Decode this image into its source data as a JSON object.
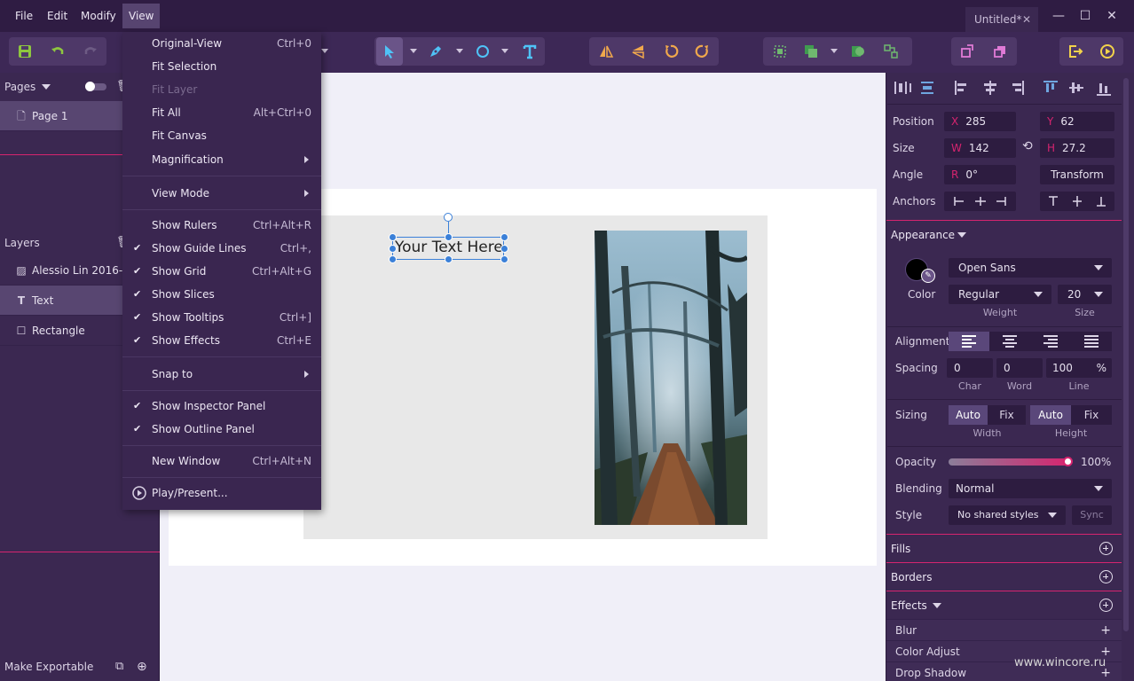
{
  "menubar": {
    "file": "File",
    "edit": "Edit",
    "modify": "Modify",
    "view": "View"
  },
  "document_tab": {
    "title": "Untitled*",
    "close": "✕"
  },
  "window_controls": {
    "minimize": "—",
    "maximize": "☐",
    "close": "✕"
  },
  "view_menu": {
    "items": [
      {
        "label": "Original-View",
        "shortcut": "Ctrl+0"
      },
      {
        "label": "Fit Selection",
        "shortcut": ""
      },
      {
        "label": "Fit Layer",
        "shortcut": ""
      },
      {
        "label": "Fit All",
        "shortcut": "Alt+Ctrl+0"
      },
      {
        "label": "Fit Canvas",
        "shortcut": ""
      },
      {
        "label": "Magnification",
        "shortcut": ""
      },
      {
        "label": "View Mode",
        "shortcut": ""
      },
      {
        "label": "Show Rulers",
        "shortcut": "Ctrl+Alt+R"
      },
      {
        "label": "Show Guide Lines",
        "shortcut": "Ctrl+,"
      },
      {
        "label": "Show Grid",
        "shortcut": "Ctrl+Alt+G"
      },
      {
        "label": "Show Slices",
        "shortcut": ""
      },
      {
        "label": "Show Tooltips",
        "shortcut": "Ctrl+]"
      },
      {
        "label": "Show Effects",
        "shortcut": "Ctrl+E"
      },
      {
        "label": "Snap to",
        "shortcut": ""
      },
      {
        "label": "Show Inspector Panel",
        "shortcut": ""
      },
      {
        "label": "Show Outline Panel",
        "shortcut": ""
      },
      {
        "label": "New Window",
        "shortcut": "Ctrl+Alt+N"
      },
      {
        "label": "Play/Present...",
        "shortcut": ""
      }
    ],
    "check": "✔"
  },
  "left_panel": {
    "pages_label": "Pages",
    "pages": [
      {
        "label": "Page 1"
      }
    ],
    "layers_label": "Layers",
    "layers": [
      {
        "label": "Alessio Lin 2016-..."
      },
      {
        "label": "Text"
      },
      {
        "label": "Rectangle"
      }
    ],
    "footer_label": "Make Exportable"
  },
  "canvas": {
    "text_layer": "Your Text Here"
  },
  "inspector": {
    "position_label": "Position",
    "x_prefix": "X",
    "x_value": "285",
    "y_prefix": "Y",
    "y_value": "62",
    "size_label": "Size",
    "w_prefix": "W",
    "w_value": "142",
    "h_prefix": "H",
    "h_value": "27.2",
    "angle_label": "Angle",
    "r_prefix": "R",
    "r_value": "0°",
    "transform_button": "Transform",
    "anchors_label": "Anchors",
    "appearance_label": "Appearance",
    "color_label": "Color",
    "font_family": "Open Sans",
    "font_weight": "Regular",
    "font_size": "20",
    "weight_label": "Weight",
    "size_sub_label": "Size",
    "alignment_label": "Alignment",
    "spacing_label": "Spacing",
    "char_value": "0",
    "word_value": "0",
    "line_value": "100",
    "percent": "%",
    "char_label": "Char",
    "word_label": "Word",
    "line_label": "Line",
    "sizing_label": "Sizing",
    "auto_label": "Auto",
    "fix_label": "Fix",
    "width_label": "Width",
    "height_label": "Height",
    "opacity_label": "Opacity",
    "opacity_value": "100%",
    "blending_label": "Blending",
    "blending_value": "Normal",
    "style_label": "Style",
    "style_value": "No shared styles",
    "sync_button": "Sync",
    "fills_label": "Fills",
    "borders_label": "Borders",
    "effects_label": "Effects",
    "effects": [
      {
        "label": "Blur"
      },
      {
        "label": "Color Adjust"
      },
      {
        "label": "Drop Shadow"
      }
    ]
  },
  "watermark": "www.wincore.ru",
  "colors": {
    "accent": "#d6246f",
    "selection": "#3b80d8",
    "panel": "#3b2851",
    "titlebar": "#2f1c43"
  }
}
